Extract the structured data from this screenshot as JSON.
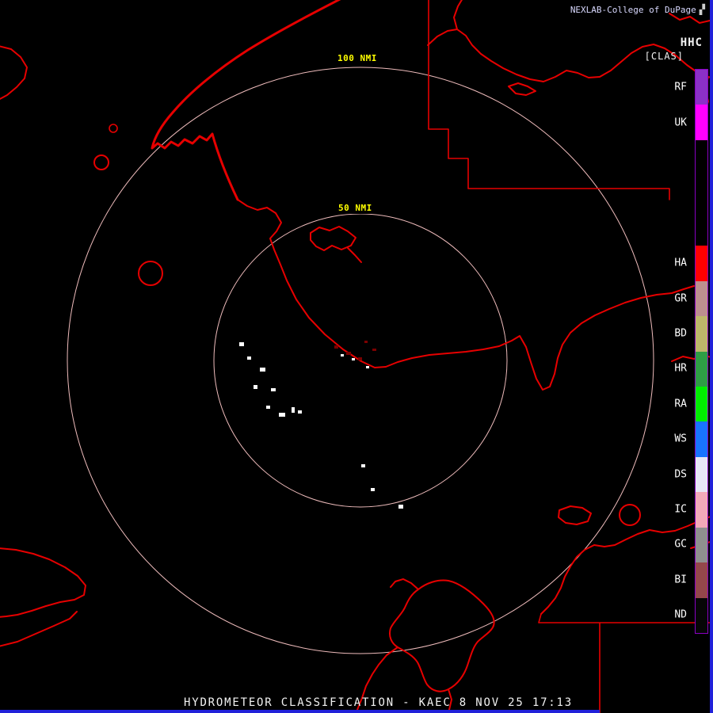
{
  "header": {
    "source": "NEXLAB-College of DuPage",
    "logo_glyph": "▞",
    "product_code": "HHC",
    "mode": "[CLAS]"
  },
  "range_rings": {
    "outer_label": "100 NMI",
    "inner_label": "50 NMI",
    "radii_nmi": [
      50,
      100
    ]
  },
  "status_bar": {
    "text": "HYDROMETEOR CLASSIFICATION - KAEC 8 NOV 25 17:13",
    "product_name": "HYDROMETEOR CLASSIFICATION",
    "station": "KAEC",
    "date": "8 NOV 25",
    "time": "17:13"
  },
  "legend": {
    "items": [
      {
        "label": "RF",
        "color": "#8b30c8"
      },
      {
        "label": "UK",
        "color": "#ff00ff"
      },
      {
        "label": "",
        "color": "#000000"
      },
      {
        "label": "",
        "color": "#000000"
      },
      {
        "label": "",
        "color": "#000000"
      },
      {
        "label": "HA",
        "color": "#ff0000"
      },
      {
        "label": "GR",
        "color": "#bc8f8f"
      },
      {
        "label": "BD",
        "color": "#bdb76a"
      },
      {
        "label": "HR",
        "color": "#2e9e45"
      },
      {
        "label": "RA",
        "color": "#00ee00"
      },
      {
        "label": "WS",
        "color": "#1874ff"
      },
      {
        "label": "DS",
        "color": "#e6e6f5"
      },
      {
        "label": "IC",
        "color": "#f2a9b9"
      },
      {
        "label": "GC",
        "color": "#8f8f8f"
      },
      {
        "label": "BI",
        "color": "#94474b"
      },
      {
        "label": "ND",
        "color": "#060606"
      }
    ]
  },
  "colors": {
    "map_outline": "#e60000",
    "ring": "#efbcbc",
    "range_label": "#ffff00",
    "title": "#d9d9ff",
    "text": "#f2f2f2",
    "legend_label": "#ffffff",
    "legend_border": "#8a00c4",
    "frame_bar": "#2121d9",
    "echo_white": "#ffffff",
    "echo_dark": "#7c0000"
  }
}
